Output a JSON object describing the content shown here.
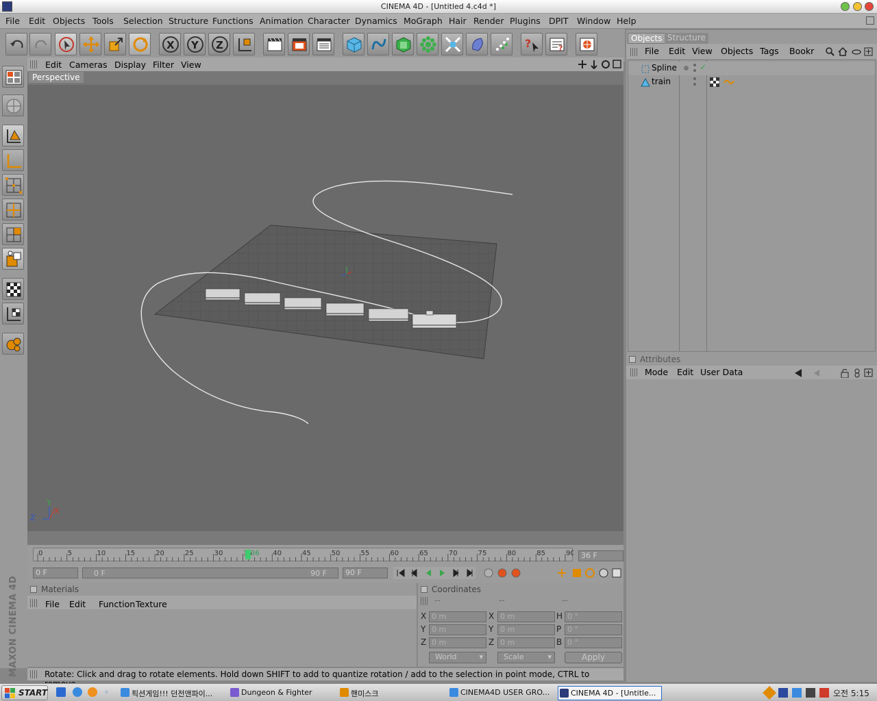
{
  "window": {
    "title": "CINEMA 4D - [Untitled 4.c4d *]"
  },
  "menu": [
    "File",
    "Edit",
    "Objects",
    "Tools",
    "Selection",
    "Structure",
    "Functions",
    "Animation",
    "Character",
    "Dynamics",
    "MoGraph",
    "Hair",
    "Render",
    "Plugins",
    "DPIT",
    "Window",
    "Help"
  ],
  "toolbar": {
    "icons": [
      "undo-icon",
      "redo-icon",
      "live-selection-icon",
      "move-icon",
      "scale-icon",
      "rotate-icon",
      "x-axis-icon",
      "y-axis-icon",
      "z-axis-icon",
      "coordinate-system-icon",
      "render-view-icon",
      "render-picture-icon",
      "render-settings-icon",
      "cube-icon",
      "spline-pen-icon",
      "nurbs-icon",
      "array-icon",
      "deformer-icon",
      "environment-icon",
      "particle-icon",
      "help-cursor-icon",
      "scene-info-icon",
      "picture-viewer-icon"
    ]
  },
  "viewport": {
    "menu": [
      "Edit",
      "Cameras",
      "Display",
      "Filter",
      "View"
    ],
    "label": "Perspective",
    "axis": {
      "z": "Z",
      "y": "Y",
      "x": "X"
    }
  },
  "left_tools": [
    "viewport-layout-icon",
    "globe-icon",
    "object-mode-icon",
    "axis-mode-icon",
    "point-mode-icon",
    "edge-mode-icon",
    "polygon-mode-icon",
    "texture-axis-icon",
    "texture-mode-icon",
    "uv-mode-icon",
    "sculpt-icon"
  ],
  "brand": "MAXON CINEMA 4D",
  "timeline": {
    "ticks": [
      "0",
      "5",
      "10",
      "15",
      "20",
      "25",
      "30",
      "35",
      "40",
      "45",
      "50",
      "55",
      "60",
      "65",
      "70",
      "75",
      "80",
      "85",
      "90"
    ],
    "current": "36",
    "current_frame": "36 F",
    "start": "0 F",
    "range_start": "0 F",
    "range_end": "90 F",
    "end": "90 F"
  },
  "materials": {
    "title": "Materials",
    "menu": [
      "File",
      "Edit",
      "Function",
      "Texture"
    ]
  },
  "coordinates": {
    "title": "Coordinates",
    "headers": [
      "--",
      "--",
      "--"
    ],
    "rows": [
      {
        "a": "X",
        "av": "0 m",
        "b": "X",
        "bv": "0 m",
        "c": "H",
        "cv": "0 °"
      },
      {
        "a": "Y",
        "av": "0 m",
        "b": "Y",
        "bv": "0 m",
        "c": "P",
        "cv": "0 °"
      },
      {
        "a": "Z",
        "av": "0 m",
        "b": "Z",
        "bv": "0 m",
        "c": "B",
        "cv": "0 °"
      }
    ],
    "world": "World",
    "scale": "Scale",
    "apply": "Apply"
  },
  "status": "Rotate: Click and drag to rotate elements. Hold down SHIFT to add to quantize rotation / add to the selection in point mode, CTRL to remove.",
  "objects": {
    "tabs": [
      "Objects",
      "Structure"
    ],
    "menu": [
      "File",
      "Edit",
      "View",
      "Objects",
      "Tags",
      "Bookr"
    ],
    "items": [
      {
        "name": "Spline"
      },
      {
        "name": "train"
      }
    ]
  },
  "attributes": {
    "title": "Attributes",
    "menu": [
      "Mode",
      "Edit",
      "User Data"
    ]
  },
  "taskbar": {
    "start": "START",
    "tasks": [
      "픽션게임!!! 던전앤파이...",
      "Dungeon & Fighter",
      "핸미스크",
      "CINEMA4D USER GRO...",
      "CINEMA 4D - [Untitle..."
    ],
    "clock": "오전 5:15"
  }
}
